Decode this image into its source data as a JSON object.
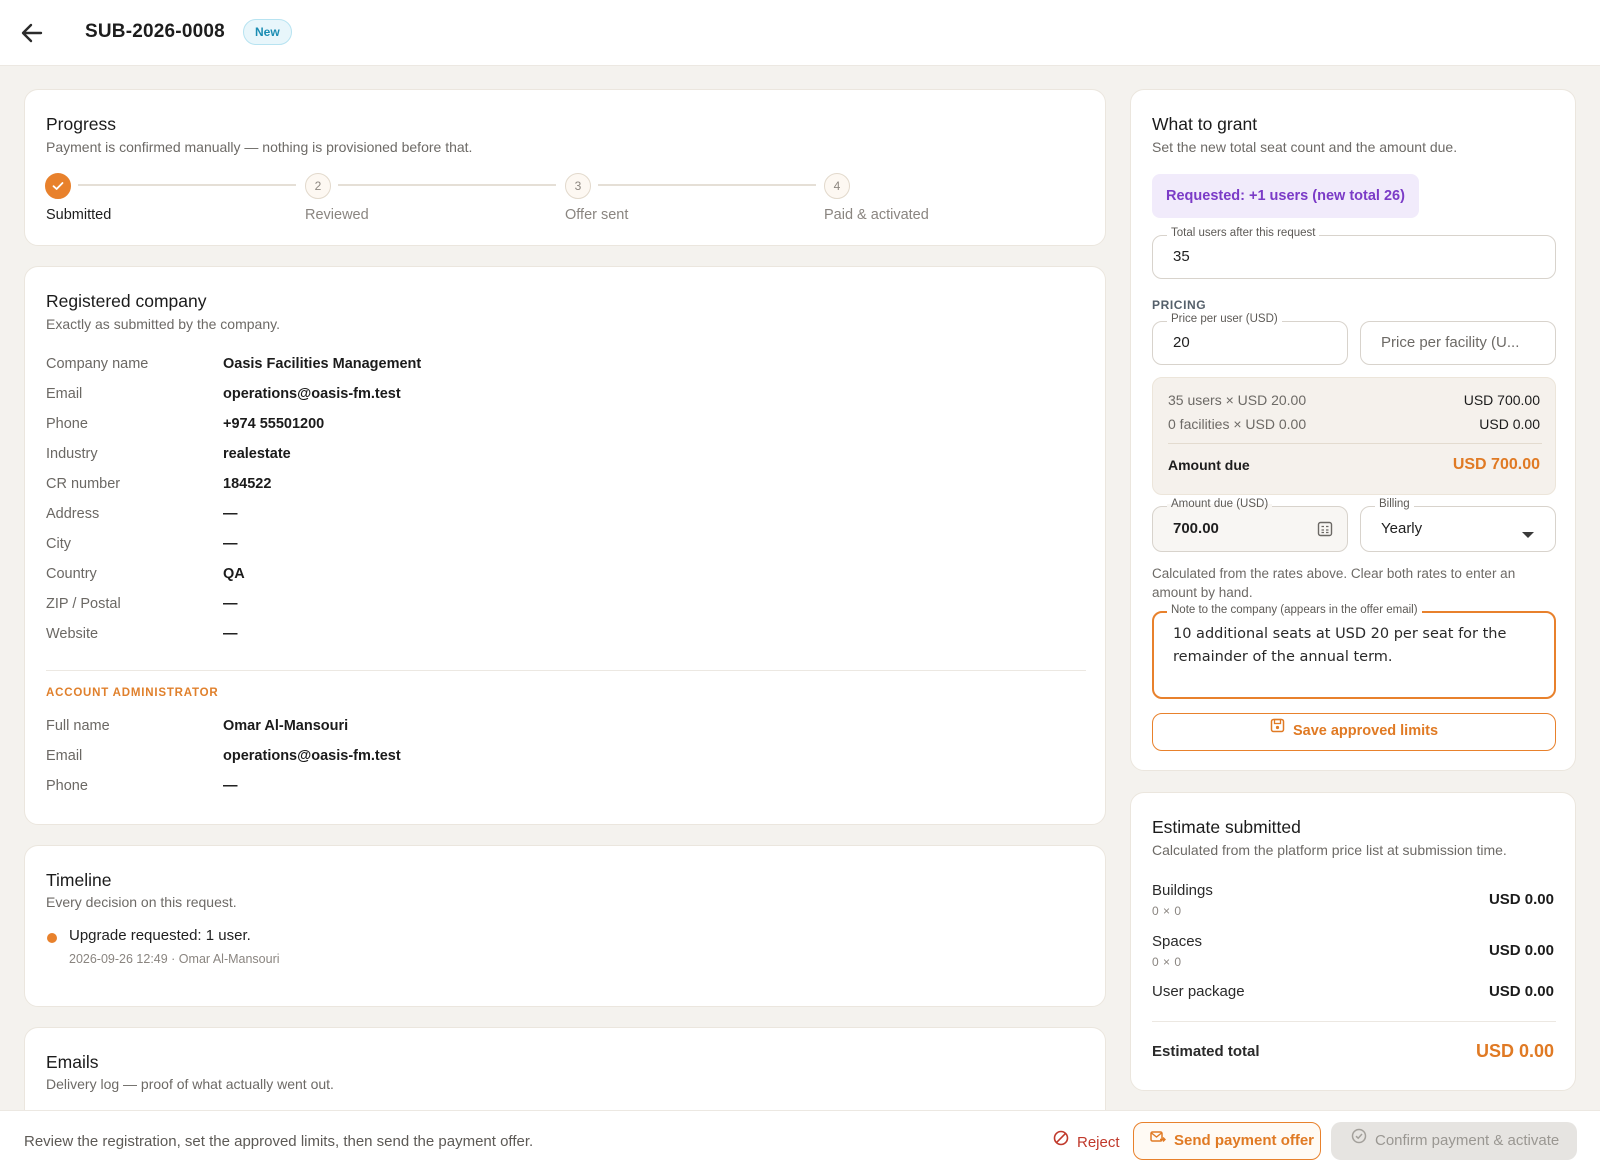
{
  "header": {
    "title": "SUB-2026-0008",
    "badge": "New"
  },
  "progress": {
    "title": "Progress",
    "subtitle": "Payment is confirmed manually — nothing is provisioned before that.",
    "steps": [
      {
        "label": "Submitted",
        "number": "✓",
        "done": true
      },
      {
        "label": "Reviewed",
        "number": "2",
        "done": false
      },
      {
        "label": "Offer sent",
        "number": "3",
        "done": false
      },
      {
        "label": "Paid & activated",
        "number": "4",
        "done": false
      }
    ]
  },
  "company": {
    "title": "Registered company",
    "subtitle": "Exactly as submitted by the company.",
    "rows": [
      {
        "label": "Company name",
        "value": "Oasis Facilities Management"
      },
      {
        "label": "Email",
        "value": "operations@oasis-fm.test"
      },
      {
        "label": "Phone",
        "value": "+974 55501200"
      },
      {
        "label": "Industry",
        "value": "realestate"
      },
      {
        "label": "CR number",
        "value": "184522"
      },
      {
        "label": "Address",
        "value": "—"
      },
      {
        "label": "City",
        "value": "—"
      },
      {
        "label": "Country",
        "value": "QA"
      },
      {
        "label": "ZIP / Postal",
        "value": "—"
      },
      {
        "label": "Website",
        "value": "—"
      }
    ],
    "admin_caption": "ACCOUNT ADMINISTRATOR",
    "admin_rows": [
      {
        "label": "Full name",
        "value": "Omar Al-Mansouri"
      },
      {
        "label": "Email",
        "value": "operations@oasis-fm.test"
      },
      {
        "label": "Phone",
        "value": "—"
      }
    ]
  },
  "timeline": {
    "title": "Timeline",
    "subtitle": "Every decision on this request.",
    "events": [
      {
        "text": "Upgrade requested: 1 user.",
        "meta": "2026-09-26 12:49 · Omar Al-Mansouri"
      }
    ]
  },
  "emails": {
    "title": "Emails",
    "subtitle": "Delivery log — proof of what actually went out."
  },
  "grant": {
    "title": "What to grant",
    "subtitle": "Set the new total seat count and the amount due.",
    "requested": "Requested: +1 users (new total 26)",
    "total_users_label": "Total users after this request",
    "total_users_value": "35",
    "pricing_caption": "PRICING",
    "price_user_label": "Price per user (USD)",
    "price_user_value": "20",
    "price_facility_placeholder": "Price per facility (U...",
    "calc_users_text": "35 users × USD 20.00",
    "calc_users_amt": "USD 700.00",
    "calc_fac_text": "0 facilities × USD 0.00",
    "calc_fac_amt": "USD 0.00",
    "amount_due_label": "Amount due",
    "amount_due_value": "USD 700.00",
    "amount_field_label": "Amount due (USD)",
    "amount_field_value": "700.00",
    "billing_label": "Billing",
    "billing_value": "Yearly",
    "help": "Calculated from the rates above. Clear both rates to enter an amount by hand.",
    "note_label": "Note to the company (appears in the offer email)",
    "note_value": "10 additional seats at USD 20 per seat for the remainder of the annual term.",
    "save_label": "Save approved limits"
  },
  "estimate": {
    "title": "Estimate submitted",
    "subtitle": "Calculated from the platform price list at submission time.",
    "items": [
      {
        "label": "Buildings",
        "sub": "0 × 0",
        "amount": "USD 0.00"
      },
      {
        "label": "Spaces",
        "sub": "0 × 0",
        "amount": "USD 0.00"
      },
      {
        "label": "User package",
        "sub": "",
        "amount": "USD 0.00"
      }
    ],
    "total_label": "Estimated total",
    "total_value": "USD 0.00"
  },
  "footer": {
    "text": "Review the registration, set the approved limits, then send the payment offer.",
    "reject_label": "Reject",
    "send_label": "Send payment offer",
    "confirm_label": "Confirm payment & activate"
  },
  "colors": {
    "accent": "#e8812c",
    "purple": "#7b3bc7",
    "danger": "#c0392b",
    "badge": "#1b8db3"
  }
}
